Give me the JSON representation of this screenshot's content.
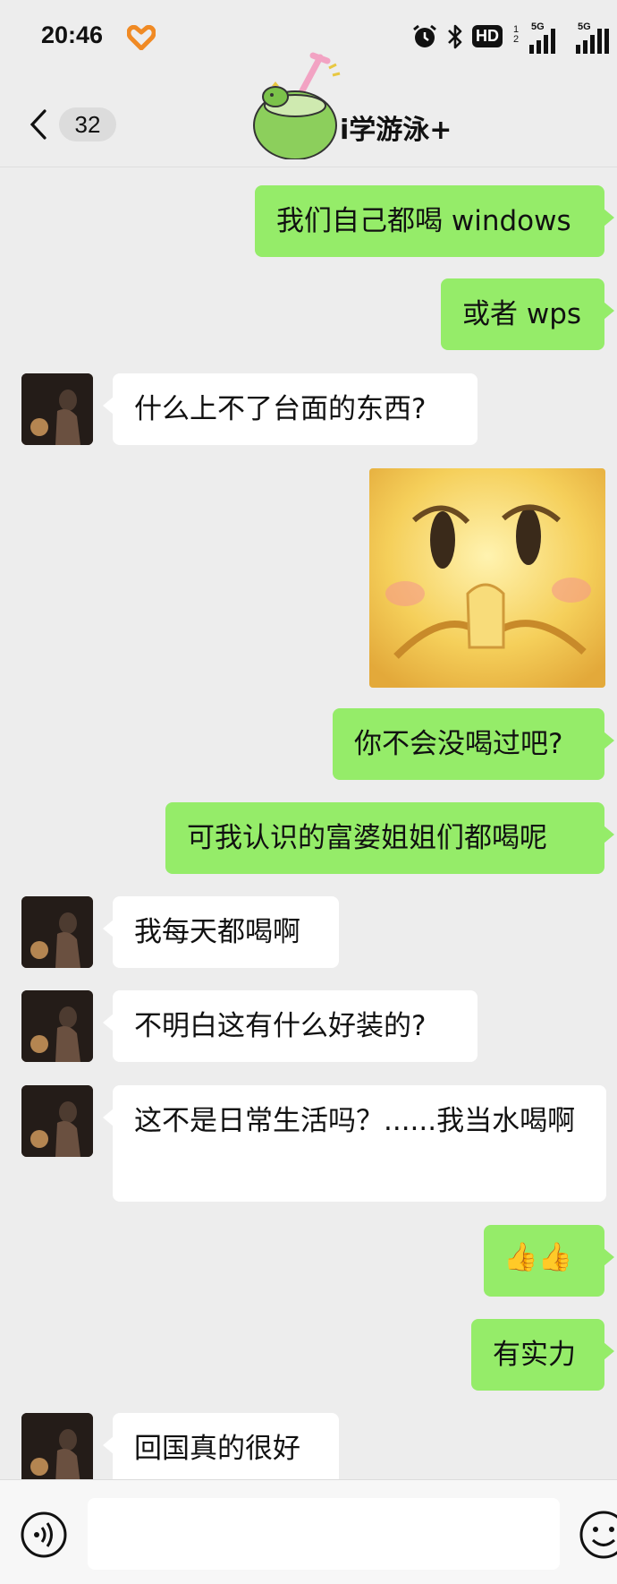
{
  "status_bar": {
    "time": "20:46",
    "hd_label": "HD",
    "hd_sub_1": "1",
    "hd_sub_2": "2",
    "signal_1_label": "5G",
    "signal_2_label": "5G",
    "icons": [
      "heart-icon",
      "alarm-icon",
      "bluetooth-icon",
      "signal-icon"
    ]
  },
  "nav": {
    "unread_count": "32",
    "title": "i学游泳+",
    "icons": [
      "chevron-left-icon",
      "coconut-avatar-icon"
    ]
  },
  "messages": [
    {
      "side": "out",
      "type": "text",
      "text": "我们自己都喝 windows"
    },
    {
      "side": "out",
      "type": "text",
      "text": "或者 wps"
    },
    {
      "side": "in",
      "type": "text",
      "text": "什么上不了台面的东西?"
    },
    {
      "side": "out",
      "type": "sticker",
      "icon": "smirk-emoji-sticker"
    },
    {
      "side": "out",
      "type": "text",
      "text": "你不会没喝过吧?"
    },
    {
      "side": "out",
      "type": "text",
      "text": "可我认识的富婆姐姐们都喝呢"
    },
    {
      "side": "in",
      "type": "text",
      "text": "我每天都喝啊"
    },
    {
      "side": "in",
      "type": "text",
      "text": "不明白这有什么好装的?"
    },
    {
      "side": "in",
      "type": "text",
      "text": "这不是日常生活吗？......我当水喝啊"
    },
    {
      "side": "out",
      "type": "text",
      "text": "👍👍"
    },
    {
      "side": "out",
      "type": "text",
      "text": "有实力"
    },
    {
      "side": "in",
      "type": "text",
      "text": "回国真的很好"
    }
  ],
  "input_bar": {
    "placeholder": "",
    "icons": [
      "voice-icon",
      "emoji-icon"
    ]
  },
  "colors": {
    "background": "#ededed",
    "outgoing_bubble": "#95ec69",
    "incoming_bubble": "#ffffff",
    "heart_accent": "#f08a24"
  }
}
